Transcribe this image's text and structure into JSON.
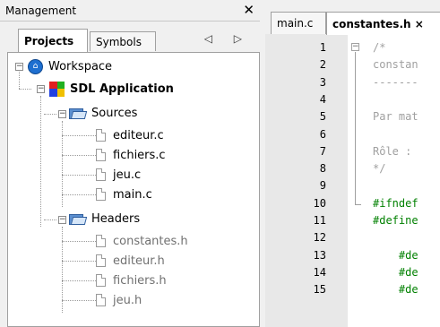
{
  "management": {
    "title": "Management",
    "close_label": "✕",
    "tabs": [
      {
        "label": "Projects"
      },
      {
        "label": "Symbols"
      }
    ],
    "tab_arrows": "◁ ▷"
  },
  "tree": {
    "workspace": "Workspace",
    "project": "SDL Application",
    "folders": [
      {
        "label": "Sources",
        "files": [
          "editeur.c",
          "fichiers.c",
          "jeu.c",
          "main.c"
        ]
      },
      {
        "label": "Headers",
        "files": [
          "constantes.h",
          "editeur.h",
          "fichiers.h",
          "jeu.h"
        ]
      }
    ],
    "expand_minus": "−"
  },
  "editor": {
    "tabs": [
      {
        "label": "main.c"
      },
      {
        "label": "constantes.h ×"
      }
    ],
    "line_numbers": [
      "1",
      "2",
      "3",
      "4",
      "5",
      "6",
      "7",
      "8",
      "9",
      "10",
      "11",
      "12",
      "13",
      "14",
      "15"
    ],
    "lines": [
      {
        "text": "/*",
        "kind": "comment"
      },
      {
        "text": "constan",
        "kind": "comment"
      },
      {
        "text": "-------",
        "kind": "comment"
      },
      {
        "text": "",
        "kind": "comment"
      },
      {
        "text": "Par mat",
        "kind": "comment"
      },
      {
        "text": "",
        "kind": "comment"
      },
      {
        "text": "Rôle :",
        "kind": "comment"
      },
      {
        "text": "*/",
        "kind": "comment"
      },
      {
        "text": "",
        "kind": "code"
      },
      {
        "text": "#ifndef",
        "kind": "pre"
      },
      {
        "text": "#define",
        "kind": "pre"
      },
      {
        "text": "",
        "kind": "code"
      },
      {
        "text": "    #de",
        "kind": "pre"
      },
      {
        "text": "    #de",
        "kind": "pre"
      },
      {
        "text": "    #de",
        "kind": "pre"
      }
    ],
    "fold_minus": "−"
  },
  "colors": {
    "comment": "#a0a0a0",
    "preprocessor": "#008000",
    "workspace_icon": "#1e6fd0"
  },
  "icons": [
    "close-icon",
    "workspace-icon",
    "sdl-application-icon",
    "folder-open-icon",
    "file-icon",
    "tab-scroll-left-icon",
    "tab-scroll-right-icon",
    "fold-collapse-icon"
  ]
}
